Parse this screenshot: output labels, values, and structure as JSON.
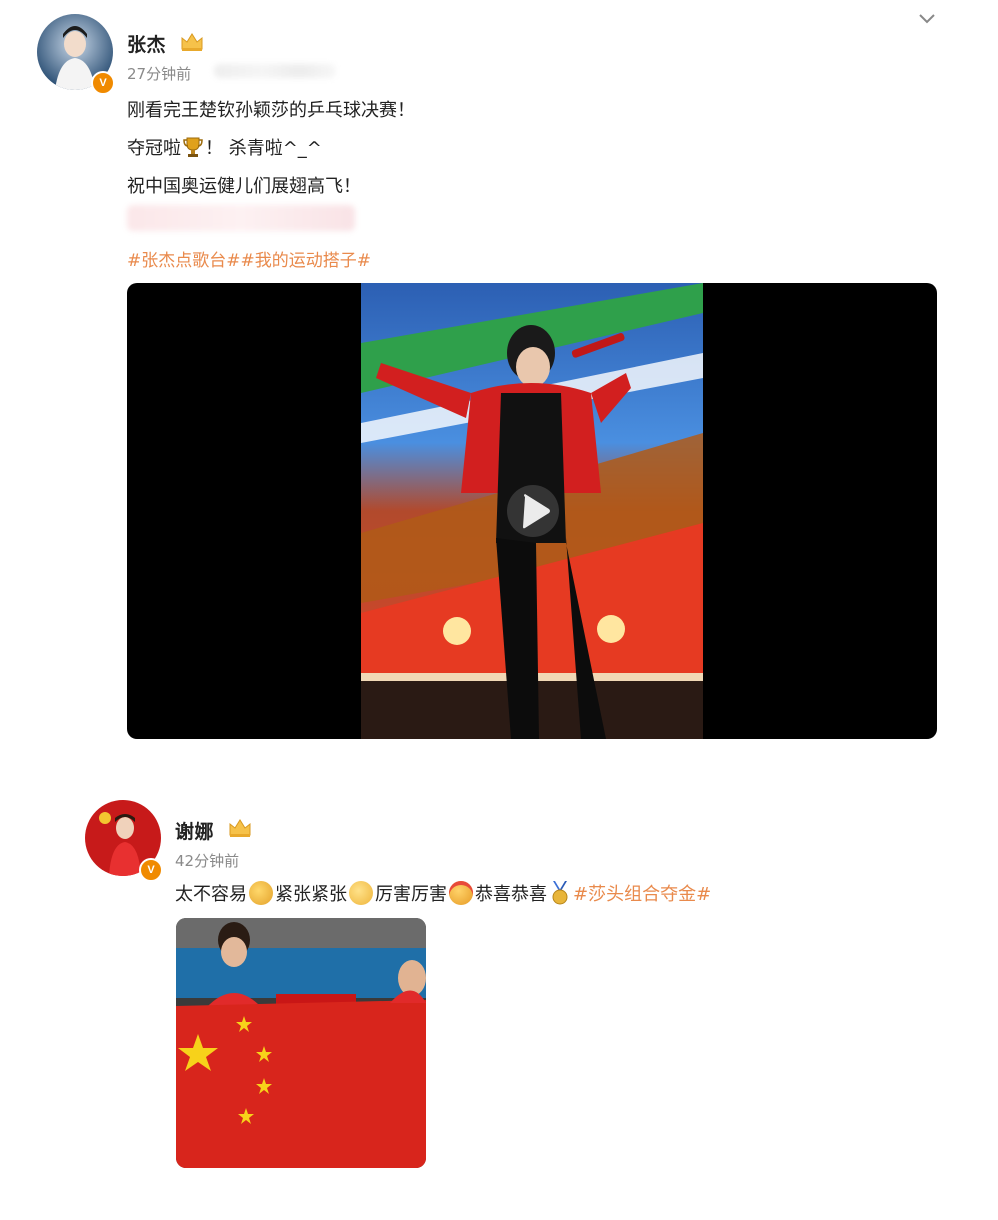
{
  "post1": {
    "name": "张杰",
    "time": "27分钟前",
    "verified_badge": "V",
    "lines": [
      "刚看完王楚钦孙颖莎的乒乓球决赛！",
      "夺冠啦",
      "！ 杀青啦^_^",
      "祝中国奥运健儿们展翅高飞！"
    ],
    "tags": "#张杰点歌台##我的运动搭子#",
    "icons": [
      "crown-icon",
      "trophy-icon",
      "play-icon",
      "chevron-down-icon"
    ]
  },
  "post2": {
    "name": "谢娜",
    "time": "42分钟前",
    "verified_badge": "V",
    "text_parts": [
      "太不容易",
      "紧张紧张",
      "厉害厉害",
      "恭喜恭喜"
    ],
    "tag": "#莎头组合夺金#",
    "icons": [
      "crown-icon",
      "fist-emoji-icon",
      "nervous-emoji-icon",
      "clap-emoji-icon",
      "celebrate-emoji-icon",
      "medal-icon"
    ]
  },
  "colors": {
    "tag": "#e98a4c",
    "badge": "#f08a00",
    "time": "#8a8a8a"
  }
}
